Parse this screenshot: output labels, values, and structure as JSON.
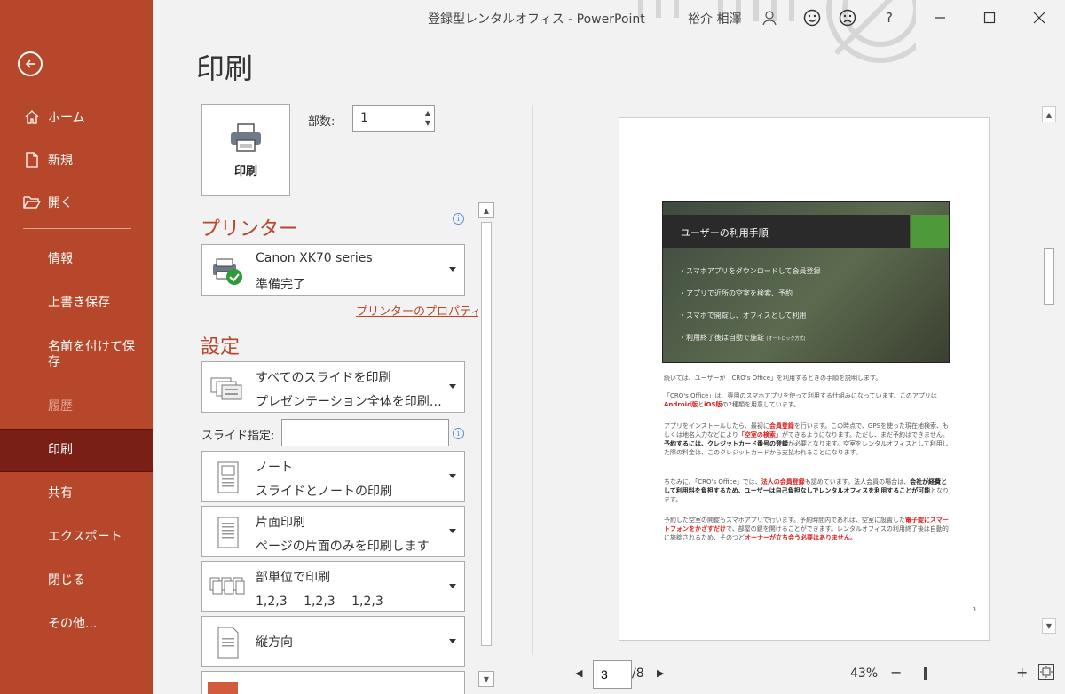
{
  "window": {
    "title": "登録型レンタルオフィス - PowerPoint",
    "user": "裕介 相澤",
    "help": "?"
  },
  "sidebar": {
    "top_items": [
      {
        "label": "ホーム",
        "icon": "home-icon"
      },
      {
        "label": "新規",
        "icon": "new-document-icon"
      },
      {
        "label": "開く",
        "icon": "open-folder-icon"
      }
    ],
    "items": [
      {
        "label": "情報"
      },
      {
        "label": "上書き保存"
      },
      {
        "label": "名前を付けて保存"
      },
      {
        "label": "履歴",
        "disabled": true
      },
      {
        "label": "印刷",
        "active": true
      },
      {
        "label": "共有"
      },
      {
        "label": "エクスポート"
      },
      {
        "label": "閉じる"
      },
      {
        "label": "その他..."
      }
    ]
  },
  "main": {
    "title": "印刷",
    "print_button": "印刷",
    "copies_label": "部数:",
    "copies_value": "1",
    "printer_header": "プリンター",
    "printer": {
      "name": "Canon XK70 series",
      "status": "準備完了"
    },
    "printer_props_link": "プリンターのプロパティ",
    "settings_header": "設定",
    "settings": [
      {
        "line1": "すべてのスライドを印刷",
        "line2": "プレゼンテーション全体を印刷…",
        "icon": "all-slides-icon"
      },
      {
        "line1": "ノート",
        "line2": "スライドとノートの印刷",
        "icon": "notes-page-icon"
      },
      {
        "line1": "片面印刷",
        "line2": "ページの片面のみを印刷します",
        "icon": "one-sided-icon"
      },
      {
        "line1": "部単位で印刷",
        "line2": "1,2,3　 1,2,3　 1,2,3",
        "icon": "collated-icon"
      },
      {
        "line1": "縦方向",
        "line2": "",
        "icon": "portrait-icon"
      }
    ],
    "slides_label": "スライド指定:",
    "slides_value": ""
  },
  "preview": {
    "slide_title": "ユーザーの利用手順",
    "bullets": [
      "・スマホアプリをダウンロードして会員登録",
      "・アプリで近所の空室を検索、予約",
      "・スマホで開錠し、オフィスとして利用",
      "・利用終了後は自動で施錠"
    ],
    "bullet_note": "(オートロック方式)",
    "notes": {
      "p1": "続いては、ユーザーが「CRO's Office」を利用するときの手順を説明します。",
      "p2a": "「CRO's Office」は、専用のスマホアプリを使って利用する仕組みになっています。このアプリは",
      "p2r1": "Android版",
      "p2b": "と",
      "p2r2": "iOS版",
      "p2c": "の2種類を用意しています。",
      "p3a": "アプリをインストールしたら、最初に",
      "p3r1": "会員登録",
      "p3b": "を行います。この時点で、GPSを使った現在地検索、もしくは地名入力などにより",
      "p3r2": "「空室の検索」",
      "p3c": "ができるようになります。ただし、まだ予約はできません。",
      "p3d": "予約するには、クレジットカード番号の登録",
      "p3e": "が必要となります。空室をレンタルオフィスとして利用した際の料金は、このクレジットカードから支払われることになります。",
      "p4a": "ちなみに、「CRO's Office」では、",
      "p4r": "法人の会員登録",
      "p4b": "も認めています。法人会員の場合は、",
      "p4c": "会社が経費として利用料を負担するため、ユーザーは自己負担なしでレンタルオフィスを利用することが可能",
      "p4d": "となります。",
      "p5a": "予約した空室の開錠もスマホアプリで行います。予約時間内であれば、空室に設置した",
      "p5r1": "電子錠にスマートフォンをかざすだけ",
      "p5b": "で、部屋の鍵を開けることができます。レンタルオフィスの利用終了後は自動的に施錠されるため、そのつど",
      "p5r2": "オーナーが立ち会う必要はありません。"
    },
    "page_number": "3"
  },
  "bottom": {
    "page_value": "3",
    "page_total": "/8",
    "zoom": "43%",
    "zoom_level_percent": 43
  }
}
